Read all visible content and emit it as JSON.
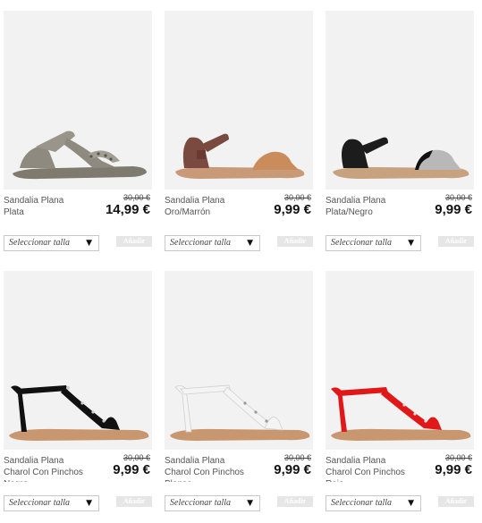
{
  "products": [
    {
      "name": "Sandalia Plana\nPlata",
      "old_price": "30,00 €",
      "price": "14,99 €",
      "size_placeholder": "Seleccionar talla",
      "add_label": "Añadir",
      "strap_color": "#8f8a80",
      "sole_color": "#7e7a6e"
    },
    {
      "name": "Sandalia Plana\nOro/Marrón",
      "old_price": "30,00 €",
      "price": "9,99 €",
      "size_placeholder": "Seleccionar talla",
      "add_label": "Añadir",
      "strap_color": "#7a4a40",
      "sole_color": "#c99a78",
      "band_color": "#c98c5a"
    },
    {
      "name": "Sandalia Plana\nPlata/Negro",
      "old_price": "30,00 €",
      "price": "9,99 €",
      "size_placeholder": "Seleccionar talla",
      "add_label": "Añadir",
      "strap_color": "#1c1c1c",
      "sole_color": "#c8a27e",
      "band_color": "#b8b8b8"
    },
    {
      "name": "Sandalia Plana\nCharol Con Pinchos\nNegro",
      "old_price": "30,00 €",
      "price": "9,99 €",
      "size_placeholder": "Seleccionar talla",
      "add_label": "Añadir",
      "strap_color": "#111111",
      "sole_color": "#c9976f"
    },
    {
      "name": "Sandalia Plana\nCharol Con Pinchos\nBlanco",
      "old_price": "30,00 €",
      "price": "9,99 €",
      "size_placeholder": "Seleccionar talla",
      "add_label": "Añadir",
      "strap_color": "#f4f4f4",
      "sole_color": "#c9976f"
    },
    {
      "name": "Sandalia Plana\nCharol Con Pinchos\nRojo",
      "old_price": "30,00 €",
      "price": "9,99 €",
      "size_placeholder": "Seleccionar talla",
      "add_label": "Añadir",
      "strap_color": "#e01818",
      "sole_color": "#c9976f"
    }
  ]
}
